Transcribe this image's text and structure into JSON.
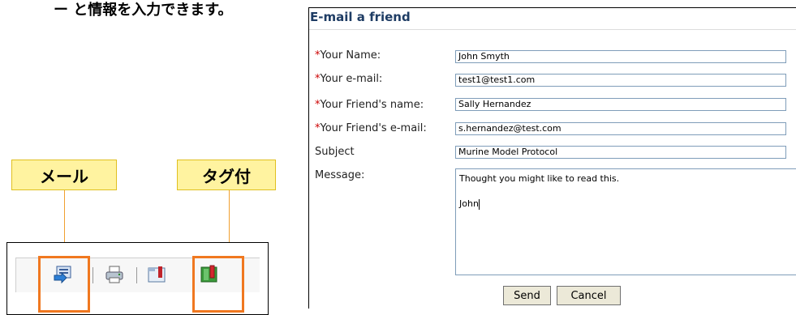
{
  "background_text": "ー と情報を入力できます。",
  "callouts": {
    "mail_label": "メール",
    "tag_label": "タグ付"
  },
  "toolbar": {
    "icons": [
      "email-icon",
      "print-icon",
      "folder-save-icon",
      "bookmark-tag-icon"
    ]
  },
  "form": {
    "title": "E-mail a friend",
    "required_marker": "*",
    "fields": [
      {
        "label": "Your Name:",
        "required": true,
        "value": "John Smyth"
      },
      {
        "label": "Your e-mail:",
        "required": true,
        "value": "test1@test1.com"
      },
      {
        "label": "Your Friend's name:",
        "required": true,
        "value": "Sally Hernandez"
      },
      {
        "label": "Your Friend's e-mail:",
        "required": true,
        "value": "s.hernandez@test.com"
      },
      {
        "label": "Subject",
        "required": false,
        "value": "Murine Model Protocol"
      }
    ],
    "message_label": "Message:",
    "message_line1": "Thought you might like to read this.",
    "message_line2": "John",
    "send_label": "Send",
    "cancel_label": "Cancel"
  },
  "colors": {
    "title": "#1e3c64",
    "required": "#cc0000",
    "highlight": "#f07820",
    "callout_bg": "#fff3a0",
    "arrow": "#f0a030"
  }
}
